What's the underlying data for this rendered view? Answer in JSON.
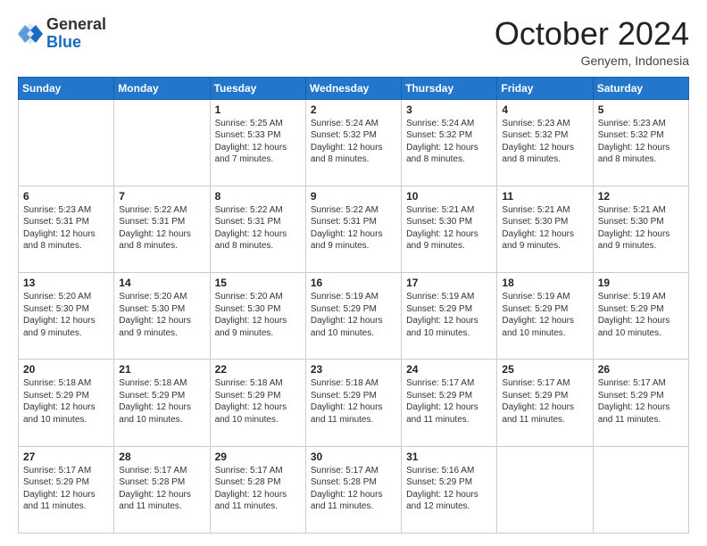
{
  "logo": {
    "general": "General",
    "blue": "Blue"
  },
  "header": {
    "month": "October 2024",
    "location": "Genyem, Indonesia"
  },
  "days_of_week": [
    "Sunday",
    "Monday",
    "Tuesday",
    "Wednesday",
    "Thursday",
    "Friday",
    "Saturday"
  ],
  "weeks": [
    [
      {
        "day": "",
        "info": ""
      },
      {
        "day": "",
        "info": ""
      },
      {
        "day": "1",
        "info": "Sunrise: 5:25 AM\nSunset: 5:33 PM\nDaylight: 12 hours and 7 minutes."
      },
      {
        "day": "2",
        "info": "Sunrise: 5:24 AM\nSunset: 5:32 PM\nDaylight: 12 hours and 8 minutes."
      },
      {
        "day": "3",
        "info": "Sunrise: 5:24 AM\nSunset: 5:32 PM\nDaylight: 12 hours and 8 minutes."
      },
      {
        "day": "4",
        "info": "Sunrise: 5:23 AM\nSunset: 5:32 PM\nDaylight: 12 hours and 8 minutes."
      },
      {
        "day": "5",
        "info": "Sunrise: 5:23 AM\nSunset: 5:32 PM\nDaylight: 12 hours and 8 minutes."
      }
    ],
    [
      {
        "day": "6",
        "info": "Sunrise: 5:23 AM\nSunset: 5:31 PM\nDaylight: 12 hours and 8 minutes."
      },
      {
        "day": "7",
        "info": "Sunrise: 5:22 AM\nSunset: 5:31 PM\nDaylight: 12 hours and 8 minutes."
      },
      {
        "day": "8",
        "info": "Sunrise: 5:22 AM\nSunset: 5:31 PM\nDaylight: 12 hours and 8 minutes."
      },
      {
        "day": "9",
        "info": "Sunrise: 5:22 AM\nSunset: 5:31 PM\nDaylight: 12 hours and 9 minutes."
      },
      {
        "day": "10",
        "info": "Sunrise: 5:21 AM\nSunset: 5:30 PM\nDaylight: 12 hours and 9 minutes."
      },
      {
        "day": "11",
        "info": "Sunrise: 5:21 AM\nSunset: 5:30 PM\nDaylight: 12 hours and 9 minutes."
      },
      {
        "day": "12",
        "info": "Sunrise: 5:21 AM\nSunset: 5:30 PM\nDaylight: 12 hours and 9 minutes."
      }
    ],
    [
      {
        "day": "13",
        "info": "Sunrise: 5:20 AM\nSunset: 5:30 PM\nDaylight: 12 hours and 9 minutes."
      },
      {
        "day": "14",
        "info": "Sunrise: 5:20 AM\nSunset: 5:30 PM\nDaylight: 12 hours and 9 minutes."
      },
      {
        "day": "15",
        "info": "Sunrise: 5:20 AM\nSunset: 5:30 PM\nDaylight: 12 hours and 9 minutes."
      },
      {
        "day": "16",
        "info": "Sunrise: 5:19 AM\nSunset: 5:29 PM\nDaylight: 12 hours and 10 minutes."
      },
      {
        "day": "17",
        "info": "Sunrise: 5:19 AM\nSunset: 5:29 PM\nDaylight: 12 hours and 10 minutes."
      },
      {
        "day": "18",
        "info": "Sunrise: 5:19 AM\nSunset: 5:29 PM\nDaylight: 12 hours and 10 minutes."
      },
      {
        "day": "19",
        "info": "Sunrise: 5:19 AM\nSunset: 5:29 PM\nDaylight: 12 hours and 10 minutes."
      }
    ],
    [
      {
        "day": "20",
        "info": "Sunrise: 5:18 AM\nSunset: 5:29 PM\nDaylight: 12 hours and 10 minutes."
      },
      {
        "day": "21",
        "info": "Sunrise: 5:18 AM\nSunset: 5:29 PM\nDaylight: 12 hours and 10 minutes."
      },
      {
        "day": "22",
        "info": "Sunrise: 5:18 AM\nSunset: 5:29 PM\nDaylight: 12 hours and 10 minutes."
      },
      {
        "day": "23",
        "info": "Sunrise: 5:18 AM\nSunset: 5:29 PM\nDaylight: 12 hours and 11 minutes."
      },
      {
        "day": "24",
        "info": "Sunrise: 5:17 AM\nSunset: 5:29 PM\nDaylight: 12 hours and 11 minutes."
      },
      {
        "day": "25",
        "info": "Sunrise: 5:17 AM\nSunset: 5:29 PM\nDaylight: 12 hours and 11 minutes."
      },
      {
        "day": "26",
        "info": "Sunrise: 5:17 AM\nSunset: 5:29 PM\nDaylight: 12 hours and 11 minutes."
      }
    ],
    [
      {
        "day": "27",
        "info": "Sunrise: 5:17 AM\nSunset: 5:29 PM\nDaylight: 12 hours and 11 minutes."
      },
      {
        "day": "28",
        "info": "Sunrise: 5:17 AM\nSunset: 5:28 PM\nDaylight: 12 hours and 11 minutes."
      },
      {
        "day": "29",
        "info": "Sunrise: 5:17 AM\nSunset: 5:28 PM\nDaylight: 12 hours and 11 minutes."
      },
      {
        "day": "30",
        "info": "Sunrise: 5:17 AM\nSunset: 5:28 PM\nDaylight: 12 hours and 11 minutes."
      },
      {
        "day": "31",
        "info": "Sunrise: 5:16 AM\nSunset: 5:29 PM\nDaylight: 12 hours and 12 minutes."
      },
      {
        "day": "",
        "info": ""
      },
      {
        "day": "",
        "info": ""
      }
    ]
  ]
}
